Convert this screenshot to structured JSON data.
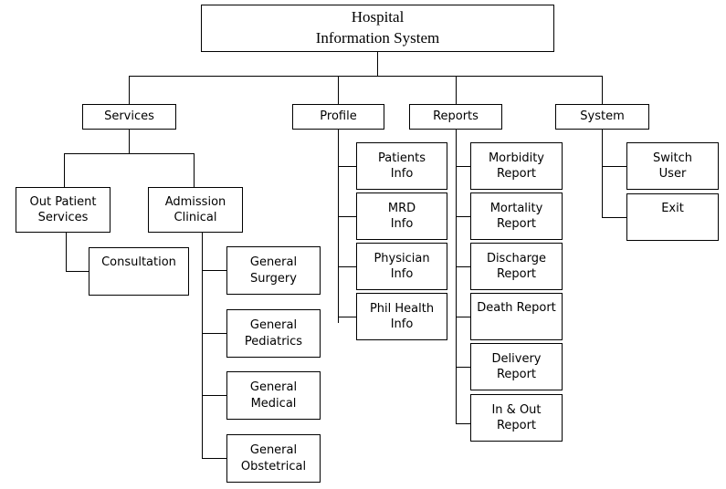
{
  "diagram": {
    "title": "Hospital Information System",
    "type": "hierarchy-tree",
    "root": {
      "label": "Hospital\nInformation System"
    },
    "branches": {
      "services": {
        "label": "Services",
        "children": [
          {
            "label": "Out Patient\nServices"
          },
          {
            "label": "Admission\nClinical"
          }
        ],
        "out_patient_children": [
          {
            "label": "Consultation"
          }
        ],
        "admission_children": [
          {
            "label": "General\nSurgery"
          },
          {
            "label": "General\nPediatrics"
          },
          {
            "label": "General\nMedical"
          },
          {
            "label": "General\nObstetrical"
          }
        ]
      },
      "profile": {
        "label": "Profile",
        "children": [
          {
            "label": "Patients\nInfo"
          },
          {
            "label": "MRD\nInfo"
          },
          {
            "label": "Physician\nInfo"
          },
          {
            "label": "Phil Health\nInfo"
          }
        ]
      },
      "reports": {
        "label": "Reports",
        "children": [
          {
            "label": "Morbidity\nReport"
          },
          {
            "label": "Mortality\nReport"
          },
          {
            "label": "Discharge\nReport"
          },
          {
            "label": "Death Report"
          },
          {
            "label": "Delivery\nReport"
          },
          {
            "label": "In & Out\nReport"
          }
        ]
      },
      "system": {
        "label": "System",
        "children": [
          {
            "label": "Switch\nUser"
          },
          {
            "label": "Exit"
          }
        ]
      }
    },
    "colors": {
      "border": "#000000",
      "background": "#ffffff",
      "text": "#000000"
    }
  }
}
